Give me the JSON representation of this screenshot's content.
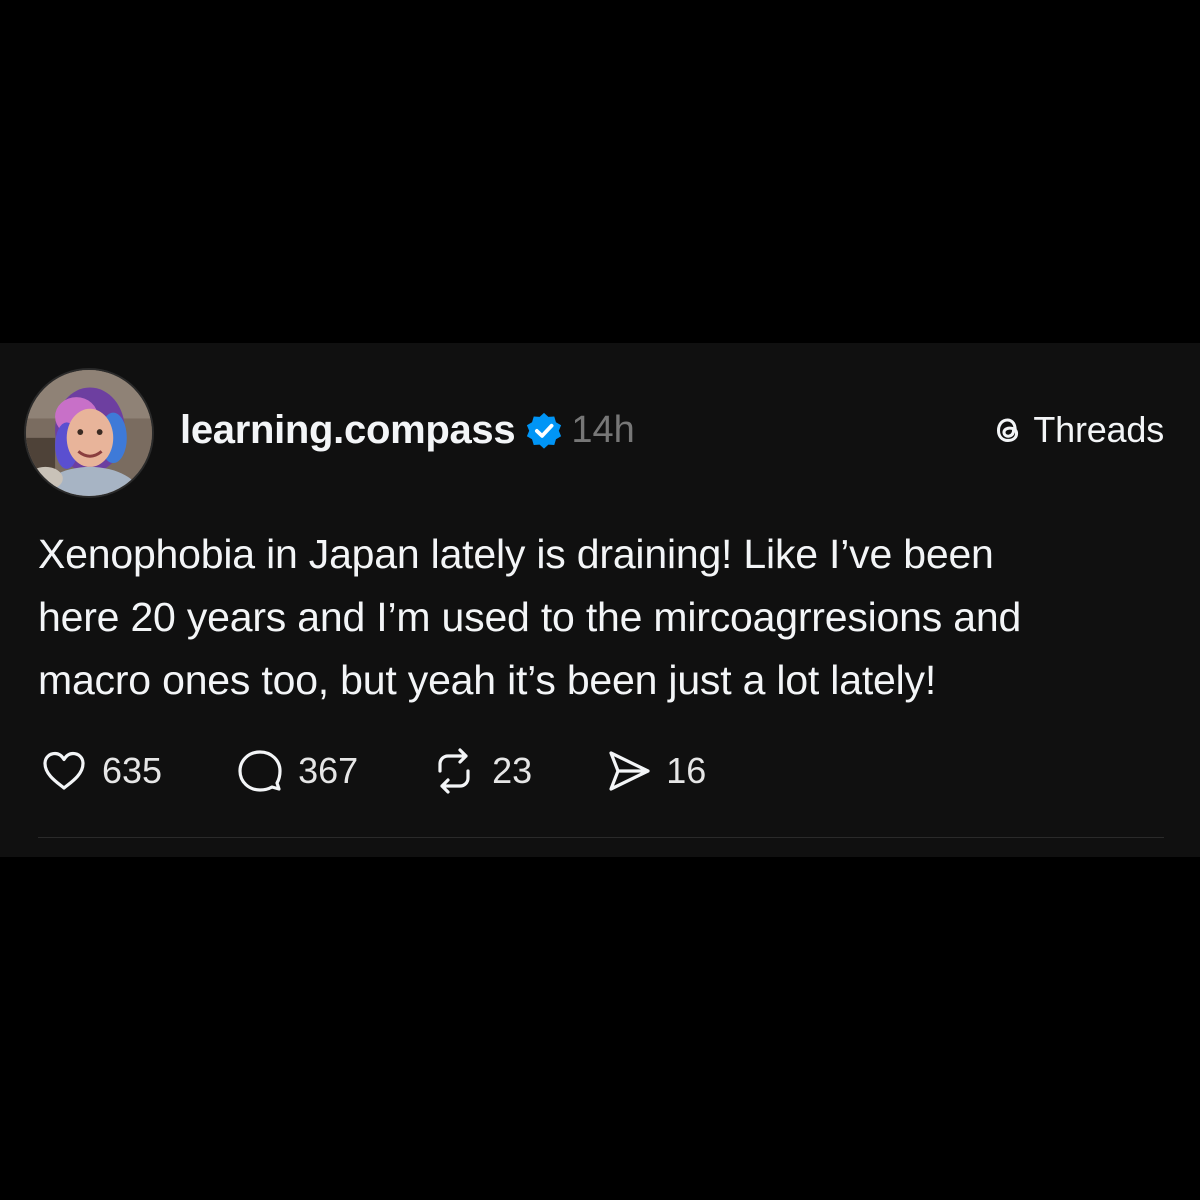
{
  "post": {
    "username": "learning.compass",
    "timestamp": "14h",
    "verified": true,
    "avatar_icon": "profile-photo",
    "text_lines": [
      "Xenophobia in Japan lately is draining! Like I’ve been",
      "here 20 years and I’m used to the mircoagrresions and",
      "macro ones too, but yeah it’s been just a lot lately!"
    ]
  },
  "brand": {
    "name": "Threads",
    "icon": "threads-logo-icon"
  },
  "actions": {
    "likes": "635",
    "replies": "367",
    "reposts": "23",
    "shares": "16"
  },
  "colors": {
    "background": "#000000",
    "card": "#101010",
    "text": "#f3f5f7",
    "muted": "#777777",
    "verified": "#0095f6"
  }
}
